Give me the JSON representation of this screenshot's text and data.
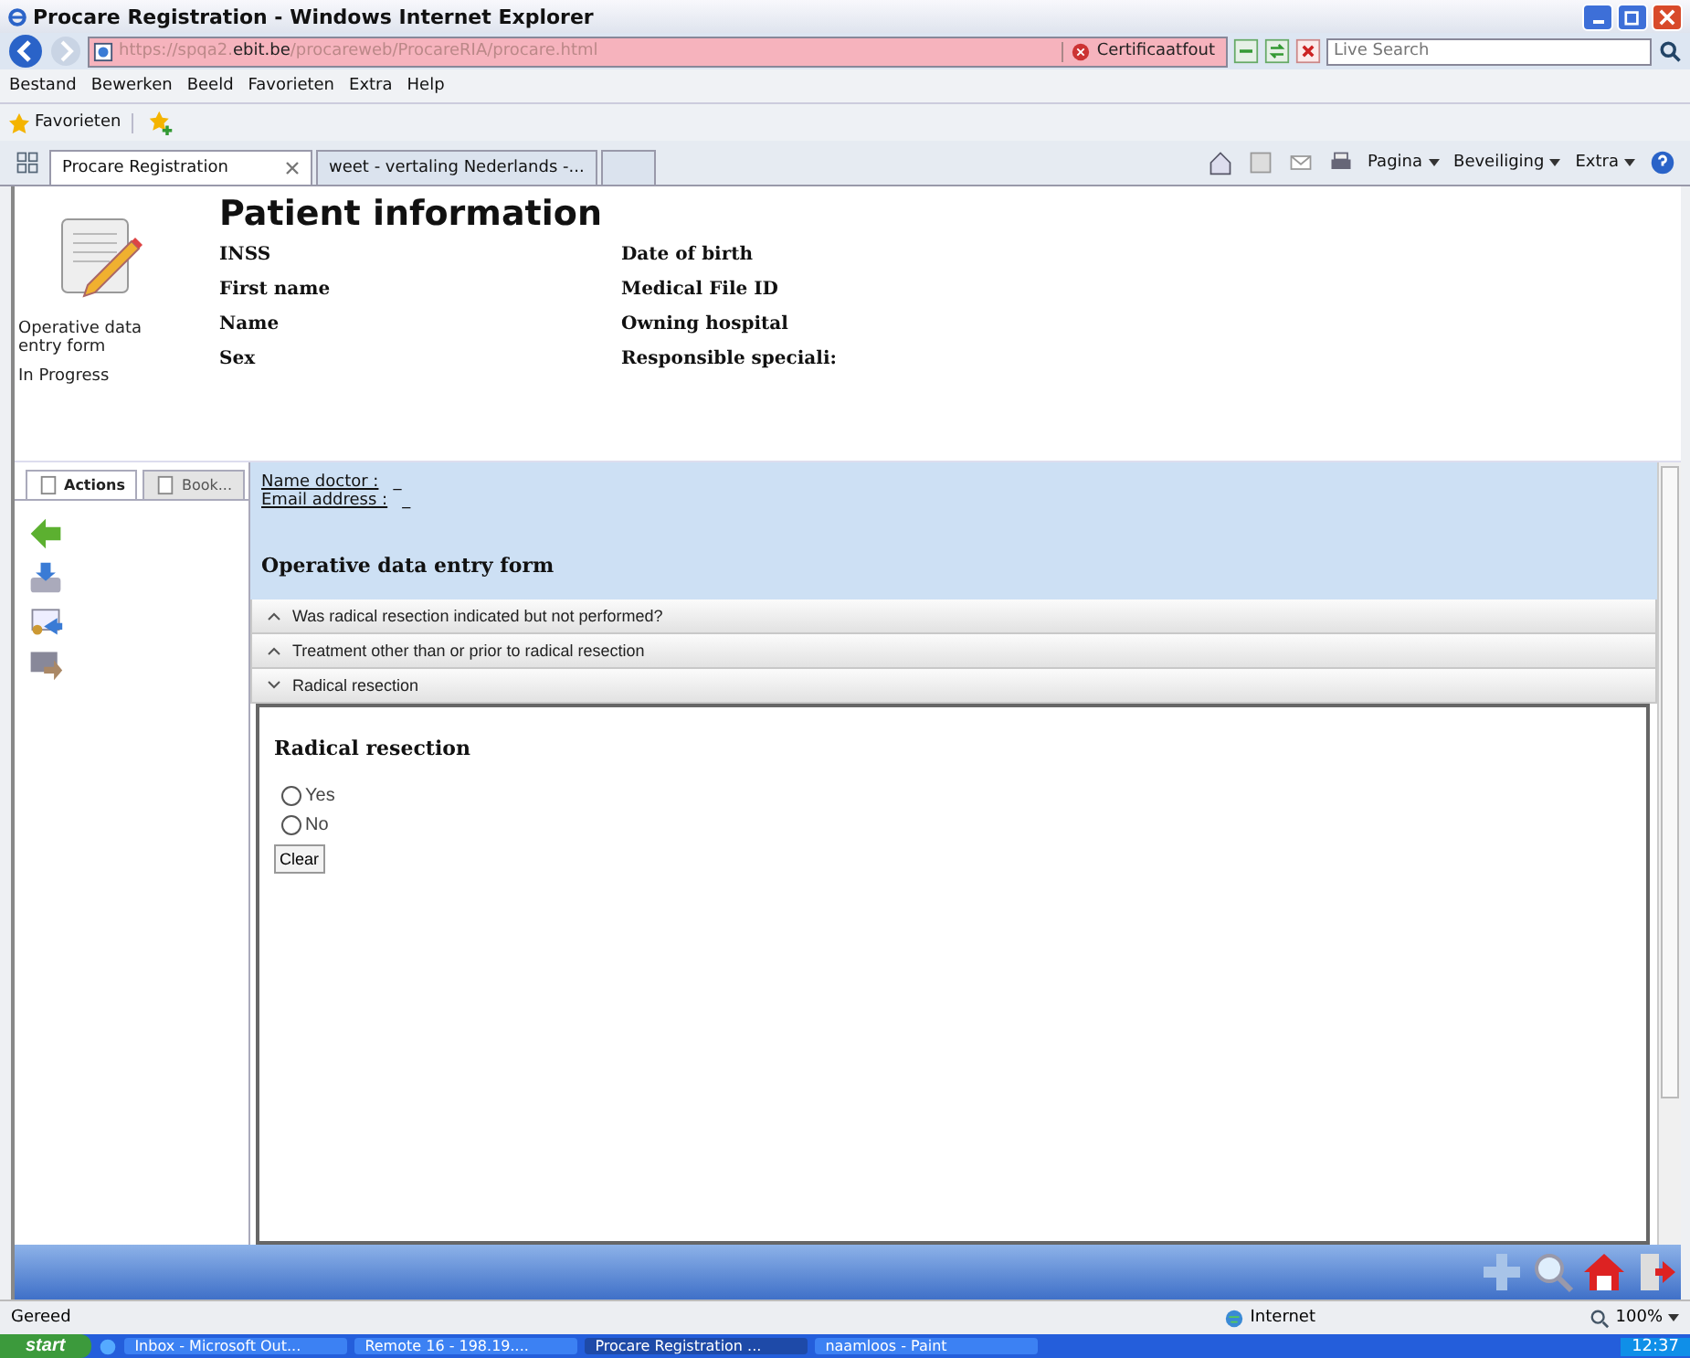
{
  "window": {
    "title": "Procare Registration - Windows Internet Explorer"
  },
  "address_bar": {
    "url": "https://spqa2.**ebit.be**/procareweb/ProcareRIA/procare.html",
    "certificate": "Certificaatfout",
    "search_placeholder": "Live Search"
  },
  "menu": [
    "Bestand",
    "Bewerken",
    "Beeld",
    "Favorieten",
    "Extra",
    "Help"
  ],
  "favorites_bar": {
    "label": "Favorieten"
  },
  "browser_tabs": [
    {
      "label": "Procare Registration",
      "selected": true
    },
    {
      "label": "weet - vertaling Nederlands -...",
      "selected": false
    }
  ],
  "command_bar": [
    "Pagina",
    "Beveiliging",
    "Extra"
  ],
  "patient": {
    "title": "Patient information",
    "form_name": "Operative data entry form",
    "status": "In Progress",
    "left_fields": [
      "INSS",
      "First name",
      "Name",
      "Sex"
    ],
    "right_fields": [
      "Date of birth",
      "Medical File ID",
      "Owning hospital",
      "Responsible speciali:"
    ]
  },
  "side_tabs": [
    {
      "label": "Actions",
      "selected": true
    },
    {
      "label": "Book...",
      "selected": false
    }
  ],
  "contact": [
    {
      "label": "Name doctor :",
      "value": "_"
    },
    {
      "label": "Email address :",
      "value": "_"
    }
  ],
  "form_title": "Operative data entry form",
  "sections": [
    {
      "label": "Was radical resection indicated but not performed?",
      "expanded": false
    },
    {
      "label": "Treatment other than or prior to radical resection",
      "expanded": false
    },
    {
      "label": "Radical resection",
      "expanded": true
    }
  ],
  "question": {
    "title": "Radical resection",
    "options": [
      {
        "label": "Yes",
        "selected": false
      },
      {
        "label": "No",
        "selected": false
      }
    ],
    "clear": "Clear"
  },
  "status_bar": {
    "text": "Gereed",
    "zone": "Internet",
    "zoom": "100%"
  },
  "taskbar": {
    "start": "start",
    "items": [
      {
        "label": "Inbox - Microsoft Out...",
        "selected": false
      },
      {
        "label": "Remote 16 - 198.19....",
        "selected": false
      },
      {
        "label": "Procare Registration ...",
        "selected": true
      },
      {
        "label": "naamloos - Paint",
        "selected": false
      }
    ],
    "clock": "12:37"
  }
}
